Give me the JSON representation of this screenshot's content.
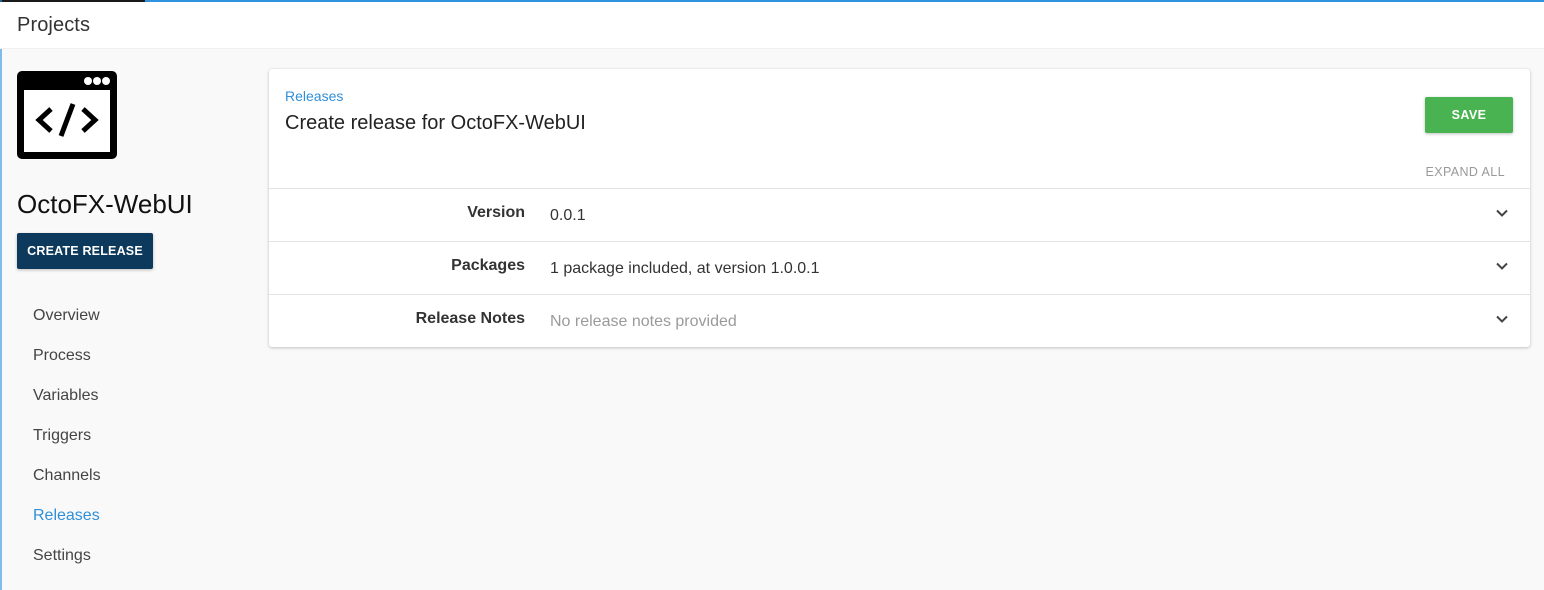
{
  "header": {
    "title": "Projects"
  },
  "project": {
    "name": "OctoFX-WebUI",
    "icon": "code-window-icon",
    "create_release_label": "CREATE RELEASE"
  },
  "sidebar": {
    "items": [
      {
        "label": "Overview",
        "active": false
      },
      {
        "label": "Process",
        "active": false
      },
      {
        "label": "Variables",
        "active": false
      },
      {
        "label": "Triggers",
        "active": false
      },
      {
        "label": "Channels",
        "active": false
      },
      {
        "label": "Releases",
        "active": true
      },
      {
        "label": "Settings",
        "active": false
      }
    ]
  },
  "main": {
    "breadcrumb": "Releases",
    "title": "Create release for OctoFX-WebUI",
    "save_label": "SAVE",
    "expand_all_label": "EXPAND ALL",
    "rows": [
      {
        "label": "Version",
        "value": "0.0.1",
        "muted": false
      },
      {
        "label": "Packages",
        "value": "1 package included, at version 1.0.0.1",
        "muted": false
      },
      {
        "label": "Release Notes",
        "value": "No release notes provided",
        "muted": true
      }
    ]
  },
  "colors": {
    "accent": "#2f8fd8",
    "primary_button": "#0d3a5c",
    "save_button": "#48b350"
  }
}
